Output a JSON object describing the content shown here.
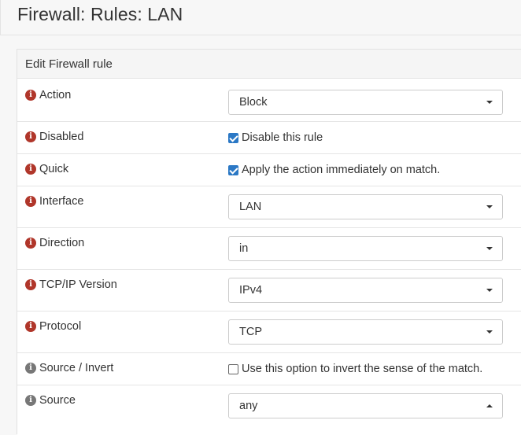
{
  "page": {
    "title": "Firewall: Rules: LAN"
  },
  "panel": {
    "heading": "Edit Firewall rule"
  },
  "fields": {
    "action": {
      "label": "Action",
      "value": "Block"
    },
    "disabled": {
      "label": "Disabled",
      "checkbox_label": "Disable this rule",
      "checked": true
    },
    "quick": {
      "label": "Quick",
      "checkbox_label": "Apply the action immediately on match.",
      "checked": true
    },
    "interface": {
      "label": "Interface",
      "value": "LAN"
    },
    "direction": {
      "label": "Direction",
      "value": "in"
    },
    "tcpip_version": {
      "label": "TCP/IP Version",
      "value": "IPv4"
    },
    "protocol": {
      "label": "Protocol",
      "value": "TCP"
    },
    "source_invert": {
      "label": "Source / Invert",
      "checkbox_label": "Use this option to invert the sense of the match.",
      "checked": false
    },
    "source": {
      "label": "Source",
      "value": "any"
    }
  },
  "icons": {
    "info": "i"
  },
  "colors": {
    "info_icon": "#b0362a",
    "info_icon_muted": "#777777",
    "checkbox_checked": "#2b78c5"
  }
}
